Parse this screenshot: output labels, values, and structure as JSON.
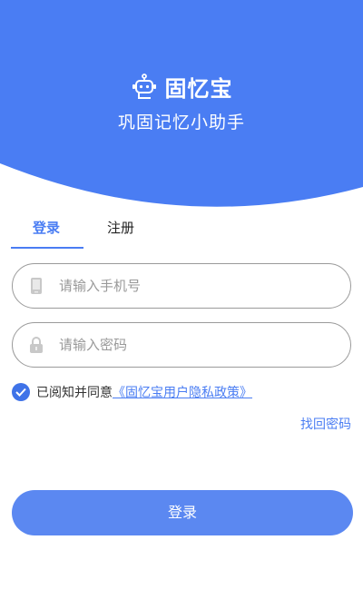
{
  "header": {
    "app_name": "固忆宝",
    "slogan": "巩固记忆小助手",
    "colors": {
      "bg": "#4a7df3",
      "text": "#ffffff"
    }
  },
  "tabs": [
    {
      "label": "登录",
      "active": true
    },
    {
      "label": "注册",
      "active": false
    }
  ],
  "form": {
    "phone": {
      "placeholder": "请输入手机号",
      "value": "",
      "icon": "phone-icon"
    },
    "password": {
      "placeholder": "请输入密码",
      "value": "",
      "icon": "lock-icon"
    }
  },
  "agreement": {
    "checked": true,
    "text": "已阅知并同意",
    "link": "《固忆宝用户隐私政策》"
  },
  "forgot_password": "找回密码",
  "login_button": "登录",
  "colors": {
    "accent": "#4a7df3",
    "button": "#5b88f1",
    "border": "#9a9a9a"
  }
}
